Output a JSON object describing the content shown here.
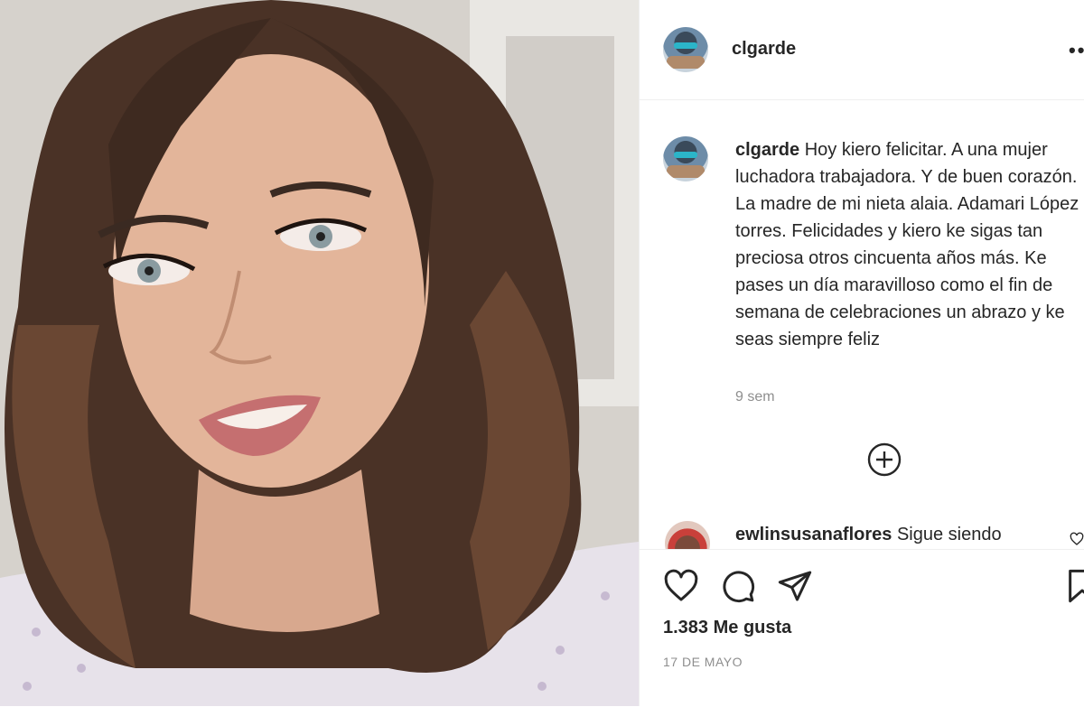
{
  "post": {
    "username": "clgarde",
    "more_label": "••",
    "caption_user": "clgarde",
    "caption_text": " Hoy kiero felicitar. A una mujer luchadora trabajadora. Y de buen corazón. La madre de mi nieta alaia. Adamari López torres. Felicidades y kiero ke sigas tan preciosa otros cincuenta años más. Ke pases un día maravilloso como el fin de semana de celebraciones un abrazo y ke seas siempre feliz",
    "time_ago": "9 sem",
    "next_comment_user": "ewlinsusanaflores",
    "next_comment_text": " Sigue siendo",
    "likes": "1.383 Me gusta",
    "date": "17 DE MAYO"
  },
  "icons": {
    "like": "heart-icon",
    "comment": "comment-icon",
    "share": "share-icon",
    "save": "bookmark-icon",
    "load_more": "plus-circle-icon"
  },
  "colors": {
    "text": "#262626",
    "secondary": "#8e8e8e",
    "border": "#efefef"
  }
}
